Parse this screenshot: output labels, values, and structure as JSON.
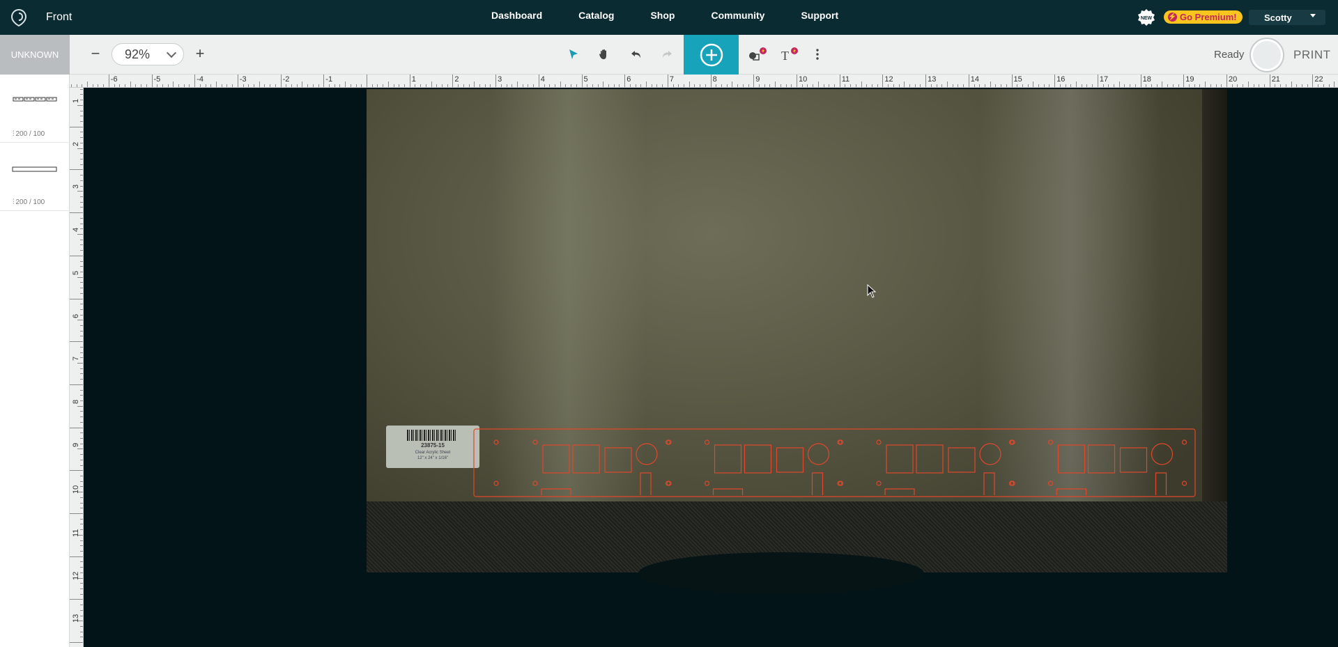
{
  "app": {
    "document_title": "Front",
    "nav": [
      "Dashboard",
      "Catalog",
      "Shop",
      "Community",
      "Support"
    ],
    "new_badge": "NEW",
    "premium_label": "Go Premium!",
    "user_name": "Scotty"
  },
  "toolbar": {
    "material": "UNKNOWN",
    "zoom_minus": "−",
    "zoom_value": "92%",
    "zoom_plus": "+",
    "status": "Ready",
    "print_label": "PRINT"
  },
  "left_panel": {
    "items": [
      {
        "power_speed": "200 / 100",
        "thumb": "pattern"
      },
      {
        "power_speed": "200 / 100",
        "thumb": "rectangle"
      }
    ]
  },
  "ruler": {
    "top_labels": [
      "-6",
      "-5",
      "-4",
      "-3",
      "-2",
      "-1",
      "1",
      "2",
      "3",
      "4",
      "5",
      "6",
      "7",
      "8",
      "9",
      "10",
      "11",
      "12",
      "13",
      "14",
      "15",
      "16",
      "17",
      "18",
      "19",
      "20",
      "21",
      "22"
    ],
    "left_labels": [
      "1",
      "2",
      "3",
      "4",
      "5",
      "6",
      "7",
      "8",
      "9",
      "10",
      "11",
      "12",
      "13"
    ]
  },
  "bed": {
    "sticker_code": "23875-15",
    "sticker_desc_1": "Clear Acrylic Sheet",
    "sticker_desc_2": "12\" x 24\" x 1/16\""
  },
  "colors": {
    "nav_bg": "#0b2b33",
    "accent": "#17a3b9",
    "premium": "#f7c51e",
    "cut_line": "#e0472c"
  }
}
